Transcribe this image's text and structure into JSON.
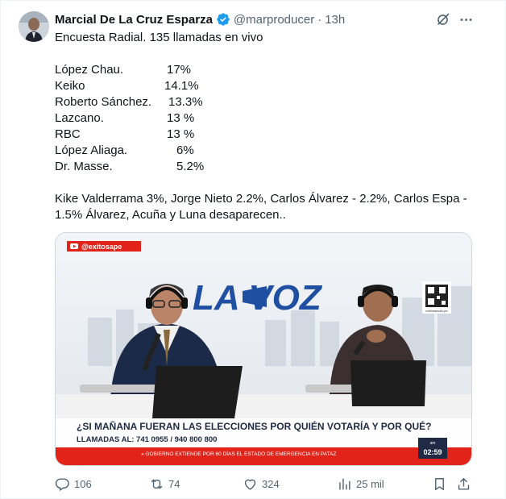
{
  "author": {
    "name": "Marcial De La Cruz Esparza",
    "handle": "@marproducer",
    "separator": "·",
    "time": "13h"
  },
  "tweet": {
    "headline": "Encuesta Radial. 135 llamadas en vivo",
    "poll": [
      {
        "candidate": "López Chau.",
        "percent": "17%"
      },
      {
        "candidate": "Keiko",
        "percent": "14.1%"
      },
      {
        "candidate": "Roberto Sánchez.",
        "percent": "13.3%"
      },
      {
        "candidate": "Lazcano.",
        "percent": "13 %"
      },
      {
        "candidate": "RBC",
        "percent": "13 %"
      },
      {
        "candidate": "López Aliaga.",
        "percent": "6%"
      },
      {
        "candidate": "Dr. Masse.",
        "percent": "5.2%"
      }
    ],
    "footer_line1": "Kike Valderrama 3%, Jorge Nieto 2.2%, Carlos Álvarez - 2.2%, Carlos Espa -",
    "footer_line2": "1.5% Álvarez, Acuña y Luna desaparecen.."
  },
  "media": {
    "channel_tag": "@exitosape",
    "studio_sign": "LA VOZ",
    "lower_third_question": "¿SI MAÑANA FUERAN LAS ELECCIONES POR QUIÉN VOTARÍA Y POR QUÉ?",
    "lower_third_phone": "LLAMADAS AL: 741 0955 / 940 800 800",
    "ticker": "» GOBIERNO EXTIENDE POR 60 DÍAS EL ESTADO DE EMERGENCIA EN PATAZ",
    "clock": "02:59",
    "qr_caption": "exitosaradio.pe",
    "clock_label": "am"
  },
  "stats": {
    "replies": "106",
    "reposts": "74",
    "likes": "324",
    "views": "25 mil"
  },
  "colors": {
    "text": "#0f1419",
    "secondary": "#536471",
    "verified": "#1d9bf0",
    "exitosa_red": "#e2231a",
    "voz_blue": "#1f4fa0"
  },
  "icons": [
    "verified-badge-icon",
    "grok-icon",
    "more-icon",
    "reply-icon",
    "repost-icon",
    "like-icon",
    "views-icon",
    "bookmark-icon",
    "share-icon"
  ]
}
